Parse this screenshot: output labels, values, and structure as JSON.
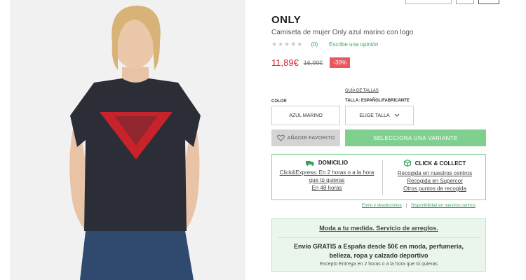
{
  "product": {
    "brand": "ONLY",
    "name": "Camiseta de mujer Only azul marino con logo",
    "stars": "★★★★★",
    "rating_count": "(0)",
    "review_link": "Escribe una opinión",
    "price": "11,89€",
    "old_price": "16,99€",
    "discount": "-30%"
  },
  "options": {
    "size_guide": "GUÍA DE TALLAS",
    "color_label": "COLOR",
    "color_value": "AZUL MARINO",
    "size_label": "TALLA: ESPAÑOL/FABRICANTE",
    "size_placeholder": "ELIGE TALLA"
  },
  "actions": {
    "favorite": "AÑADIR FAVORITO",
    "select_variant": "SELECCIONA UNA VARIANTE"
  },
  "delivery": {
    "home_title": "DOMICILIO",
    "home_line1": "Click&Express: En 2 horas o a la hora",
    "home_line2": "que tú quieras",
    "home_line3": "En 48 horas",
    "collect_title": "CLICK & COLLECT",
    "collect_line1": "Recogida en nuestros centros",
    "collect_line2": "Recogida en Supercor",
    "collect_line3": "Otros puntos de recogida"
  },
  "help": {
    "shipping_returns": "Envío y devoluciones",
    "separator": "|",
    "availability": "Disponibilidad en nuestros centros"
  },
  "alteration": {
    "title": "Moda a tu medida. Servicio de arreglos.",
    "shipping": "Envío GRATIS a España desde 50€ en moda, perfumería, belleza, ropa y calzado deportivo",
    "note": "Excepto Entrega en 2 horas o a la hora que tú quieras"
  },
  "colors": {
    "price_red": "#d4202b",
    "discount_bg": "#e8585e",
    "green_accent": "#3aa35c",
    "variant_button": "#7fcf8f"
  }
}
